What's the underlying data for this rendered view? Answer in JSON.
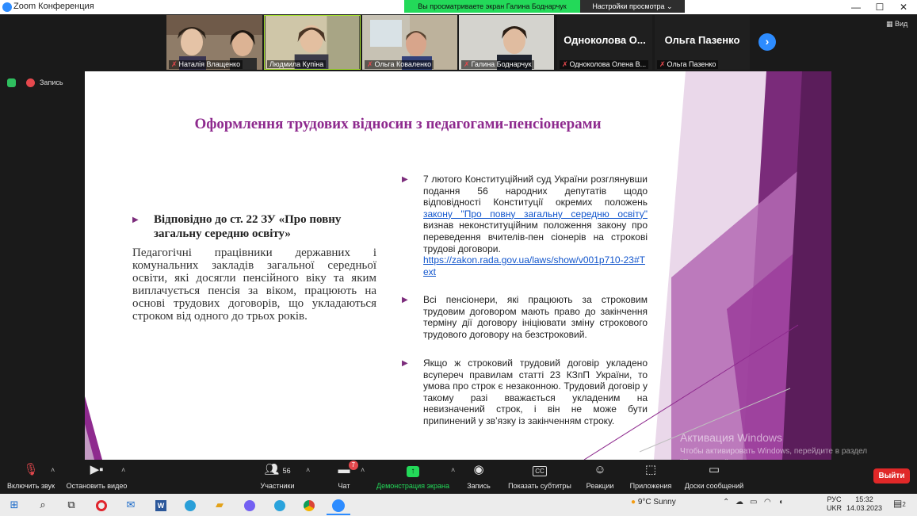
{
  "window": {
    "title": "Zoom Конференция",
    "share_banner": "Вы просматриваете экран Галина Боднарчук",
    "view_options": "Настройки просмотра ⌄",
    "view_label": "Вид"
  },
  "participants": [
    {
      "name": "Наталія Влащенко",
      "has_video": true
    },
    {
      "name": "Людмила Купіна",
      "has_video": true
    },
    {
      "name": "Ольга Коваленко",
      "has_video": true
    },
    {
      "name": "Галина Боднарчук",
      "has_video": true
    },
    {
      "name": "Одноколова Олена В...",
      "display": "Одноколова О...",
      "has_video": false
    },
    {
      "name": "Ольга Пазенко",
      "display": "Ольга Пазенко",
      "has_video": false
    }
  ],
  "recording": {
    "label": "Запись"
  },
  "slide": {
    "title": "Оформлення трудових відносин з  педагогами-пенсіонерами",
    "left_heading": "Відповідно до ст. 22 ЗУ «Про повну загальну середню освіту»",
    "left_body": "Педагогічні працівники державних і комунальних закладів загальної середньої освіти, які досягли пенсійного віку та яким виплачується пенсія за віком, працюють на основі трудових договорів, що укладаються строком від одного до трьох років.",
    "bullet1_before": "7 лютого Конституційний суд України розглянувши подання 56 народних депутатів щодо відповідності Конституції окремих положень ",
    "bullet1_link": "закону \"Про повну загальну середню освіту\"",
    "bullet1_after": " визнав неконституційним положення закону про переведення вчителів-пен сіонерів на строкові трудові договори.",
    "bullet1_url": "https://zakon.rada.gov.ua/laws/show/v001p710-23#Text",
    "bullet2": "Всі пенсіонери, які працюють за строковим трудовим договором мають право до закінчення терміну дії договору ініціювати зміну строкового трудового договору на безстроковий.",
    "bullet3": "Якщо ж строковий трудовий договір укладено всупереч правилам статті 23 КЗпП України, то умова про строк є незаконною. Трудовий договір у такому разі вважається укладеним на невизначений строк, і він не може бути припинений у зв’язку із закінченням строку."
  },
  "watermark": {
    "line1": "Активация Windows",
    "line2": "Чтобы активировать Windows, перейдите в раздел \"Параметры\"."
  },
  "toolbar": {
    "unmute": "Включить звук",
    "start_video": "Остановить видео",
    "participants": "Участники",
    "participants_count": "56",
    "chat": "Чат",
    "chat_badge": "7",
    "share_screen": "Демонстрация экрана",
    "record": "Запись",
    "captions": "Показать субтитры",
    "reactions": "Реакции",
    "apps": "Приложения",
    "whiteboards": "Доски сообщений",
    "leave": "Выйти"
  },
  "taskbar": {
    "weather": "9°C  Sunny",
    "lang_top": "РУС",
    "lang_bottom": "UKR",
    "time": "15:32",
    "date": "14.03.2023",
    "notification_count": "2"
  },
  "colors": {
    "accent_purple": "#8e2a8e",
    "zoom_blue": "#2d8cff",
    "share_green": "#23d959",
    "leave_red": "#e02828"
  }
}
